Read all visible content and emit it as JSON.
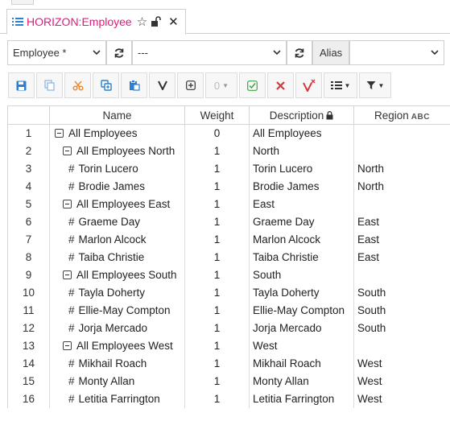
{
  "tab": {
    "title": "HORIZON:Employee",
    "star_icon": "star-outline-icon",
    "lock_icon": "unlocked-icon",
    "close_icon": "close-icon"
  },
  "selectors": {
    "dimension": "Employee *",
    "subset": "---",
    "alias_label": "Alias",
    "alias_value": ""
  },
  "toolbar": {
    "buttons": [
      "save-icon",
      "copy-icon",
      "cut-icon",
      "duplicate-icon",
      "paste-icon",
      "filter-v-icon",
      "add-element-icon",
      "level-dropdown",
      "check-icon",
      "delete-icon",
      "clear-filter-icon",
      "list-dropdown",
      "funnel-dropdown"
    ],
    "level_value": "0"
  },
  "grid": {
    "columns": [
      "",
      "Name",
      "Weight",
      "Description",
      "Region"
    ],
    "region_badge": "ABC",
    "rows": [
      {
        "n": "1",
        "name": "All Employees",
        "type": "consolidated",
        "level": 0,
        "weight": "0",
        "description": "All Employees",
        "region": ""
      },
      {
        "n": "2",
        "name": "All Employees North",
        "type": "consolidated",
        "level": 1,
        "weight": "1",
        "description": "North",
        "region": ""
      },
      {
        "n": "3",
        "name": "Torin Lucero",
        "type": "leaf",
        "level": 2,
        "weight": "1",
        "description": "Torin Lucero",
        "region": "North"
      },
      {
        "n": "4",
        "name": "Brodie James",
        "type": "leaf",
        "level": 2,
        "weight": "1",
        "description": "Brodie James",
        "region": "North"
      },
      {
        "n": "5",
        "name": "All Employees East",
        "type": "consolidated",
        "level": 1,
        "weight": "1",
        "description": "East",
        "region": ""
      },
      {
        "n": "6",
        "name": "Graeme Day",
        "type": "leaf",
        "level": 2,
        "weight": "1",
        "description": "Graeme Day",
        "region": "East"
      },
      {
        "n": "7",
        "name": "Marlon Alcock",
        "type": "leaf",
        "level": 2,
        "weight": "1",
        "description": "Marlon Alcock",
        "region": "East"
      },
      {
        "n": "8",
        "name": "Taiba Christie",
        "type": "leaf",
        "level": 2,
        "weight": "1",
        "description": "Taiba Christie",
        "region": "East"
      },
      {
        "n": "9",
        "name": "All Employees South",
        "type": "consolidated",
        "level": 1,
        "weight": "1",
        "description": "South",
        "region": ""
      },
      {
        "n": "10",
        "name": "Tayla Doherty",
        "type": "leaf",
        "level": 2,
        "weight": "1",
        "description": "Tayla Doherty",
        "region": "South"
      },
      {
        "n": "11",
        "name": "Ellie-May Compton",
        "type": "leaf",
        "level": 2,
        "weight": "1",
        "description": "Ellie-May Compton",
        "region": "South"
      },
      {
        "n": "12",
        "name": "Jorja Mercado",
        "type": "leaf",
        "level": 2,
        "weight": "1",
        "description": "Jorja Mercado",
        "region": "South"
      },
      {
        "n": "13",
        "name": "All Employees West",
        "type": "consolidated",
        "level": 1,
        "weight": "1",
        "description": "West",
        "region": ""
      },
      {
        "n": "14",
        "name": "Mikhail Roach",
        "type": "leaf",
        "level": 2,
        "weight": "1",
        "description": "Mikhail Roach",
        "region": "West"
      },
      {
        "n": "15",
        "name": "Monty Allan",
        "type": "leaf",
        "level": 2,
        "weight": "1",
        "description": "Monty Allan",
        "region": "West"
      },
      {
        "n": "16",
        "name": "Letitia Farrington",
        "type": "leaf",
        "level": 2,
        "weight": "1",
        "description": "Letitia Farrington",
        "region": "West"
      }
    ]
  },
  "colors": {
    "tab_title": "#e0197d",
    "save": "#2b7fd4",
    "cut": "#f08a2c",
    "check": "#3aa545",
    "delete": "#d9363e"
  }
}
